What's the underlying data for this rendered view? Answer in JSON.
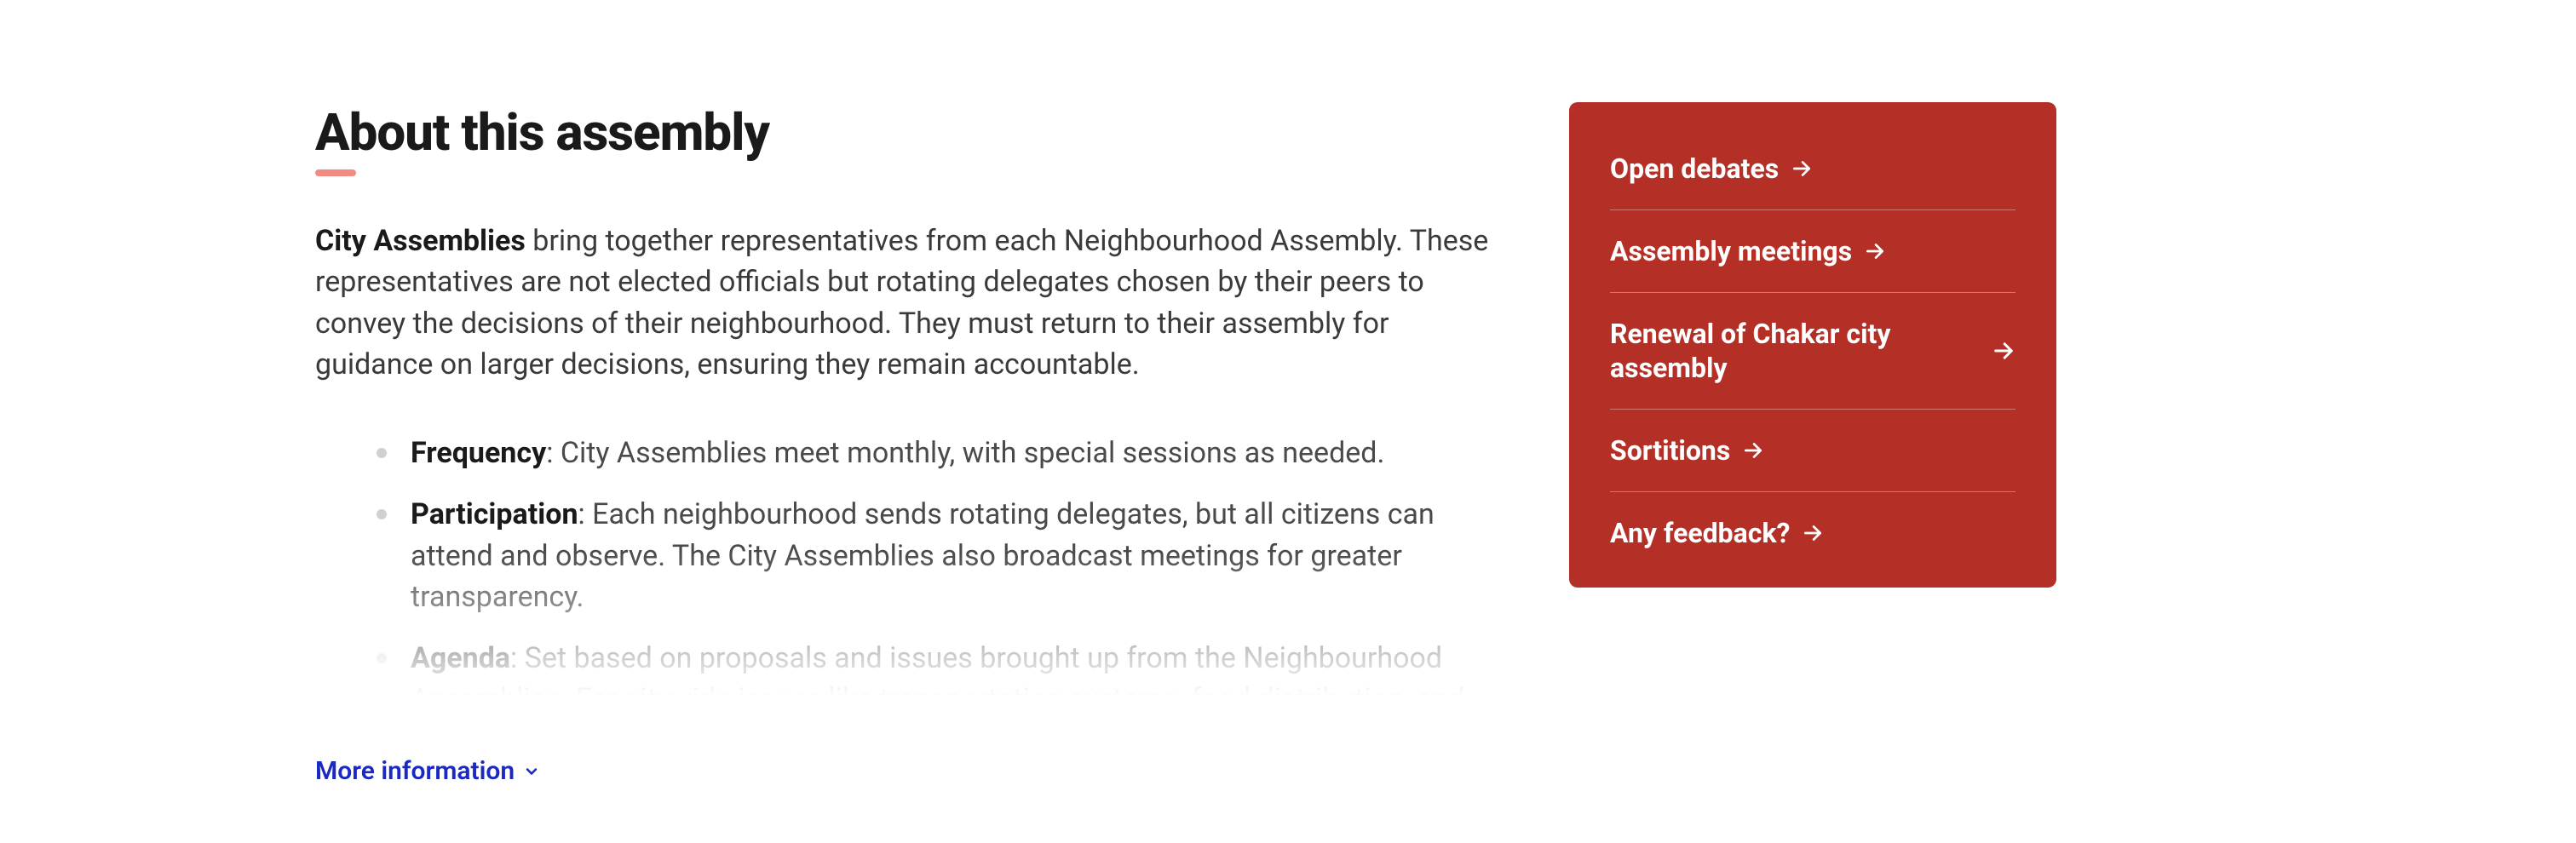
{
  "heading": "About this assembly",
  "intro_bold": "City Assemblies",
  "intro_rest": " bring together representatives from each Neighbourhood Assembly. These representatives are not elected officials but rotating delegates chosen by their peers to convey the decisions of their neighbourhood. They must return to their assembly for guidance on larger decisions, ensuring they remain accountable.",
  "bullets": [
    {
      "label": "Frequency",
      "text": ": City Assemblies meet monthly, with special sessions as needed."
    },
    {
      "label": "Participation",
      "text": ": Each neighbourhood sends rotating delegates, but all citizens can attend and observe. The City Assemblies also broadcast meetings for greater transparency."
    },
    {
      "label": "Agenda",
      "text": ": Set based on proposals and issues brought up from the Neighbourhood Assemblies. For citywide issues like transportation systems, food distribution, and utilities."
    }
  ],
  "more_info": "More information",
  "sidebar": {
    "items": [
      {
        "label": "Open debates",
        "inline": true
      },
      {
        "label": "Assembly meetings",
        "inline": true
      },
      {
        "label": "Renewal of Chakar city assembly",
        "inline": false
      },
      {
        "label": "Sortitions",
        "inline": true
      },
      {
        "label": "Any feedback?",
        "inline": true
      }
    ]
  }
}
